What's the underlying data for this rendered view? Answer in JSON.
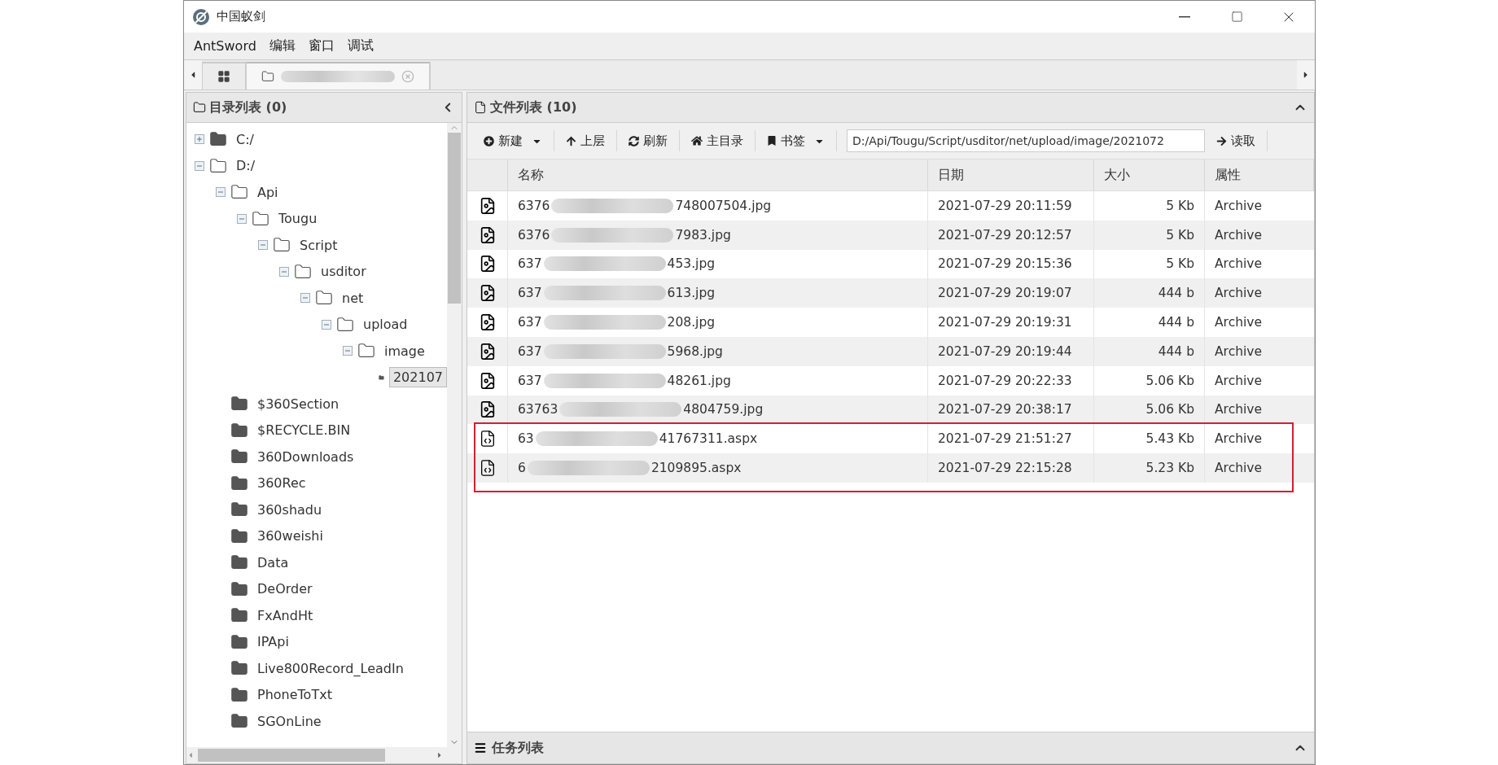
{
  "window": {
    "title": "中国蚁剑"
  },
  "menu": [
    "AntSword",
    "编辑",
    "窗口",
    "调试"
  ],
  "tabs": [
    {
      "kind": "home",
      "selected": false
    },
    {
      "kind": "folder",
      "selected": true
    }
  ],
  "tree_panel": {
    "title": "目录列表 (0)"
  },
  "tree": [
    {
      "label": "C:/",
      "expanded": false,
      "selected": false
    },
    {
      "label": "D:/",
      "expanded": true,
      "selected": false,
      "children": [
        {
          "label": "Api",
          "expanded": true,
          "selected": false,
          "children": [
            {
              "label": "Tougu",
              "expanded": true,
              "selected": false,
              "children": [
                {
                  "label": "Script",
                  "expanded": true,
                  "selected": false,
                  "children": [
                    {
                      "label": "usditor",
                      "expanded": true,
                      "selected": false,
                      "children": [
                        {
                          "label": "net",
                          "expanded": true,
                          "selected": false,
                          "children": [
                            {
                              "label": "upload",
                              "expanded": true,
                              "selected": false,
                              "children": [
                                {
                                  "label": "image",
                                  "expanded": true,
                                  "selected": false,
                                  "children": [
                                    {
                                      "label": "202107",
                                      "selected": true
                                    }
                                  ]
                                }
                              ]
                            }
                          ]
                        }
                      ]
                    }
                  ]
                }
              ]
            }
          ]
        },
        {
          "label": "$360Section",
          "selected": false
        },
        {
          "label": "$RECYCLE.BIN",
          "selected": false
        },
        {
          "label": "360Downloads",
          "selected": false
        },
        {
          "label": "360Rec",
          "selected": false
        },
        {
          "label": "360shadu",
          "selected": false
        },
        {
          "label": "360weishi",
          "selected": false
        },
        {
          "label": "Data",
          "selected": false
        },
        {
          "label": "DeOrder",
          "selected": false
        },
        {
          "label": "FxAndHt",
          "selected": false
        },
        {
          "label": "IPApi",
          "selected": false
        },
        {
          "label": "Live800Record_LeadIn",
          "selected": false
        },
        {
          "label": "PhoneToTxt",
          "selected": false
        },
        {
          "label": "SGOnLine",
          "selected": false
        }
      ]
    }
  ],
  "file_panel": {
    "title": "文件列表 (10)"
  },
  "toolbar": [
    {
      "kind": "new",
      "label": "新建",
      "dropdown": true
    },
    {
      "kind": "up",
      "label": "上层",
      "dropdown": false
    },
    {
      "kind": "refresh",
      "label": "刷新",
      "dropdown": false
    },
    {
      "kind": "home",
      "label": "主目录",
      "dropdown": false
    },
    {
      "kind": "bookmark",
      "label": "书签",
      "dropdown": true
    }
  ],
  "path_field": {
    "value": "D:/Api/Tougu/Script/usditor/net/upload/image/2021072"
  },
  "read_button": {
    "label": "读取"
  },
  "table": {
    "columns": [
      "名称",
      "日期",
      "大小",
      "属性"
    ],
    "rows": [
      {
        "kind": "image",
        "name_start": "6376",
        "name_end": "748007504.jpg",
        "date": "2021-07-29 20:11:59",
        "size": "5 Kb",
        "attribute": "Archive",
        "highlighted": false
      },
      {
        "kind": "image",
        "name_start": "6376",
        "name_end": "7983.jpg",
        "date": "2021-07-29 20:12:57",
        "size": "5 Kb",
        "attribute": "Archive",
        "highlighted": false
      },
      {
        "kind": "image",
        "name_start": "637",
        "name_end": "453.jpg",
        "date": "2021-07-29 20:15:36",
        "size": "5 Kb",
        "attribute": "Archive",
        "highlighted": false
      },
      {
        "kind": "image",
        "name_start": "637",
        "name_end": "613.jpg",
        "date": "2021-07-29 20:19:07",
        "size": "444 b",
        "attribute": "Archive",
        "highlighted": false
      },
      {
        "kind": "image",
        "name_start": "637",
        "name_end": "208.jpg",
        "date": "2021-07-29 20:19:31",
        "size": "444 b",
        "attribute": "Archive",
        "highlighted": false
      },
      {
        "kind": "image",
        "name_start": "637",
        "name_end": "5968.jpg",
        "date": "2021-07-29 20:19:44",
        "size": "444 b",
        "attribute": "Archive",
        "highlighted": false
      },
      {
        "kind": "image",
        "name_start": "637",
        "name_end": "48261.jpg",
        "date": "2021-07-29 20:22:33",
        "size": "5.06 Kb",
        "attribute": "Archive",
        "highlighted": false
      },
      {
        "kind": "image",
        "name_start": "63763",
        "name_end": "4804759.jpg",
        "date": "2021-07-29 20:38:17",
        "size": "5.06 Kb",
        "attribute": "Archive",
        "highlighted": false
      },
      {
        "kind": "code",
        "name_start": "63",
        "name_end": "41767311.aspx",
        "date": "2021-07-29 21:51:27",
        "size": "5.43 Kb",
        "attribute": "Archive",
        "highlighted": true
      },
      {
        "kind": "code",
        "name_start": "6",
        "name_end": "2109895.aspx",
        "date": "2021-07-29 22:15:28",
        "size": "5.23 Kb",
        "attribute": "Archive",
        "highlighted": true
      }
    ]
  },
  "task_panel": {
    "title": "任务列表"
  }
}
